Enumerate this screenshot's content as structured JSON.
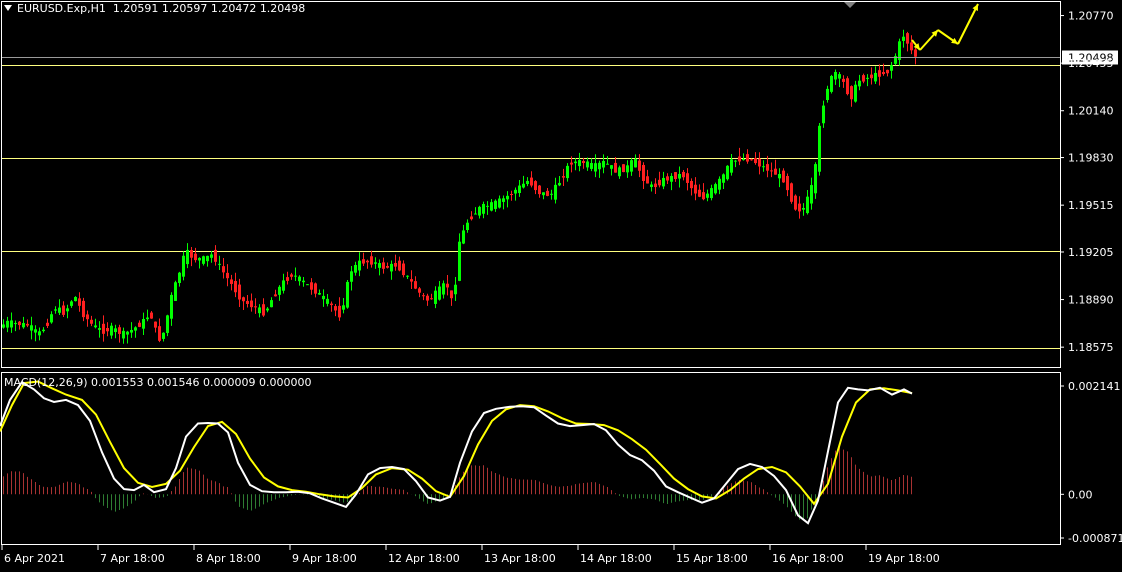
{
  "header": {
    "symbol": "EURUSD.Exp,H1",
    "ohlc": "1.20591 1.20597 1.20472 1.20498"
  },
  "macd": {
    "label": "MACD(12,26,9) 0.001553 0.001546 0.000009 0.000000",
    "axis_ticks": [
      "0.002141",
      "0.00",
      "-0.000871"
    ]
  },
  "price_axis": {
    "ticks": [
      "1.20770",
      "1.20455",
      "1.20140",
      "1.19830",
      "1.19515",
      "1.19205",
      "1.18890",
      "1.18575"
    ],
    "current_price": "1.20498"
  },
  "time_axis": {
    "labels": [
      "6 Apr 2021",
      "7 Apr 18:00",
      "8 Apr 18:00",
      "9 Apr 18:00",
      "12 Apr 18:00",
      "13 Apr 18:00",
      "14 Apr 18:00",
      "15 Apr 18:00",
      "16 Apr 18:00",
      "19 Apr 18:00"
    ]
  },
  "colors": {
    "background": "#000000",
    "bull_candle": "#00ff00",
    "bear_candle": "#ff2020",
    "level_line": "#ffff80",
    "arrow": "#ffff00",
    "macd_main": "#ffffff",
    "macd_signal": "#ffff00",
    "hist_pos": "#a83232",
    "hist_neg": "#2e7d32"
  },
  "chart_data": {
    "type": "candlestick",
    "symbol": "EURUSD.Exp",
    "timeframe": "H1",
    "ylim": [
      1.1849,
      1.2082
    ],
    "horizontal_levels": [
      1.2044,
      1.1983,
      1.1921,
      1.1857
    ],
    "price_points": [
      [
        0,
        1.187
      ],
      [
        8,
        1.1874
      ],
      [
        18,
        1.1873
      ],
      [
        30,
        1.1872
      ],
      [
        40,
        1.1866
      ],
      [
        48,
        1.1872
      ],
      [
        56,
        1.1884
      ],
      [
        66,
        1.188
      ],
      [
        76,
        1.1892
      ],
      [
        84,
        1.188
      ],
      [
        94,
        1.1872
      ],
      [
        104,
        1.1868
      ],
      [
        114,
        1.187
      ],
      [
        124,
        1.1866
      ],
      [
        134,
        1.1869
      ],
      [
        144,
        1.1874
      ],
      [
        152,
        1.188
      ],
      [
        160,
        1.1862
      ],
      [
        166,
        1.1868
      ],
      [
        172,
        1.1889
      ],
      [
        180,
        1.1905
      ],
      [
        187,
        1.1921
      ],
      [
        196,
        1.1916
      ],
      [
        206,
        1.1916
      ],
      [
        214,
        1.1919
      ],
      [
        222,
        1.191
      ],
      [
        232,
        1.19
      ],
      [
        244,
        1.1888
      ],
      [
        256,
        1.1884
      ],
      [
        266,
        1.188
      ],
      [
        274,
        1.189
      ],
      [
        284,
        1.19
      ],
      [
        294,
        1.1906
      ],
      [
        306,
        1.19
      ],
      [
        318,
        1.1894
      ],
      [
        330,
        1.1887
      ],
      [
        342,
        1.1878
      ],
      [
        352,
        1.1908
      ],
      [
        362,
        1.1914
      ],
      [
        374,
        1.1914
      ],
      [
        386,
        1.191
      ],
      [
        398,
        1.1912
      ],
      [
        410,
        1.1903
      ],
      [
        420,
        1.1894
      ],
      [
        430,
        1.1888
      ],
      [
        440,
        1.1895
      ],
      [
        448,
        1.19
      ],
      [
        455,
        1.1884
      ],
      [
        460,
        1.1926
      ],
      [
        470,
        1.1942
      ],
      [
        482,
        1.195
      ],
      [
        494,
        1.1952
      ],
      [
        506,
        1.1956
      ],
      [
        518,
        1.1962
      ],
      [
        530,
        1.1968
      ],
      [
        540,
        1.196
      ],
      [
        552,
        1.1958
      ],
      [
        562,
        1.1968
      ],
      [
        572,
        1.198
      ],
      [
        584,
        1.198
      ],
      [
        596,
        1.1977
      ],
      [
        606,
        1.198
      ],
      [
        618,
        1.1974
      ],
      [
        628,
        1.1976
      ],
      [
        636,
        1.1982
      ],
      [
        644,
        1.197
      ],
      [
        654,
        1.1963
      ],
      [
        664,
        1.1968
      ],
      [
        674,
        1.197
      ],
      [
        684,
        1.1972
      ],
      [
        694,
        1.1962
      ],
      [
        704,
        1.1956
      ],
      [
        714,
        1.1962
      ],
      [
        724,
        1.197
      ],
      [
        732,
        1.198
      ],
      [
        742,
        1.1982
      ],
      [
        752,
        1.1982
      ],
      [
        764,
        1.1977
      ],
      [
        776,
        1.1973
      ],
      [
        786,
        1.1968
      ],
      [
        796,
        1.195
      ],
      [
        804,
        1.1948
      ],
      [
        812,
        1.196
      ],
      [
        818,
        1.198
      ],
      [
        822,
        1.201
      ],
      [
        828,
        1.2028
      ],
      [
        836,
        1.204
      ],
      [
        844,
        1.2034
      ],
      [
        852,
        1.2022
      ],
      [
        860,
        1.2034
      ],
      [
        870,
        1.2036
      ],
      [
        880,
        1.2038
      ],
      [
        890,
        1.204
      ],
      [
        898,
        1.2052
      ],
      [
        904,
        1.2065
      ],
      [
        910,
        1.2058
      ],
      [
        916,
        1.205
      ]
    ],
    "macd_main": [
      [
        0,
        0.0013
      ],
      [
        10,
        0.0018
      ],
      [
        22,
        0.00214
      ],
      [
        34,
        0.002
      ],
      [
        44,
        0.00183
      ],
      [
        54,
        0.00176
      ],
      [
        66,
        0.0018
      ],
      [
        78,
        0.0017
      ],
      [
        90,
        0.0014
      ],
      [
        102,
        0.0008
      ],
      [
        114,
        0.0003
      ],
      [
        124,
        0.0001
      ],
      [
        134,
        8e-05
      ],
      [
        144,
        0.00018
      ],
      [
        154,
        4e-05
      ],
      [
        166,
        0.0001
      ],
      [
        176,
        0.0005
      ],
      [
        186,
        0.0011
      ],
      [
        198,
        0.00135
      ],
      [
        208,
        0.00136
      ],
      [
        218,
        0.00135
      ],
      [
        228,
        0.00118
      ],
      [
        238,
        0.0006
      ],
      [
        250,
        0.00018
      ],
      [
        262,
        6e-05
      ],
      [
        274,
        4e-05
      ],
      [
        286,
        4e-05
      ],
      [
        298,
        5e-05
      ],
      [
        310,
        2e-05
      ],
      [
        322,
        -8e-05
      ],
      [
        334,
        -0.00016
      ],
      [
        346,
        -0.00024
      ],
      [
        356,
        0.0
      ],
      [
        368,
        0.00038
      ],
      [
        380,
        0.0005
      ],
      [
        392,
        0.00052
      ],
      [
        404,
        0.00048
      ],
      [
        416,
        0.00025
      ],
      [
        428,
        -6e-05
      ],
      [
        440,
        -0.00012
      ],
      [
        450,
        -5e-05
      ],
      [
        460,
        0.0006
      ],
      [
        472,
        0.0012
      ],
      [
        484,
        0.00155
      ],
      [
        496,
        0.00163
      ],
      [
        510,
        0.00167
      ],
      [
        522,
        0.00168
      ],
      [
        534,
        0.00166
      ],
      [
        546,
        0.0015
      ],
      [
        558,
        0.00135
      ],
      [
        570,
        0.0013
      ],
      [
        582,
        0.00132
      ],
      [
        594,
        0.00134
      ],
      [
        606,
        0.00122
      ],
      [
        618,
        0.00095
      ],
      [
        630,
        0.00075
      ],
      [
        642,
        0.00065
      ],
      [
        654,
        0.00045
      ],
      [
        666,
        0.00015
      ],
      [
        678,
        4e-05
      ],
      [
        690,
        -6e-05
      ],
      [
        702,
        -0.00016
      ],
      [
        714,
        -8e-05
      ],
      [
        726,
        0.0002
      ],
      [
        738,
        0.00048
      ],
      [
        750,
        0.00058
      ],
      [
        762,
        0.00052
      ],
      [
        774,
        0.00035
      ],
      [
        786,
        8e-05
      ],
      [
        798,
        -0.0004
      ],
      [
        808,
        -0.00055
      ],
      [
        818,
        -0.00012
      ],
      [
        828,
        0.00082
      ],
      [
        838,
        0.00175
      ],
      [
        848,
        0.00203
      ],
      [
        858,
        0.002
      ],
      [
        868,
        0.00198
      ],
      [
        880,
        0.00203
      ],
      [
        892,
        0.0019
      ],
      [
        904,
        0.002
      ],
      [
        912,
        0.00192
      ]
    ],
    "macd_signal": [
      [
        0,
        0.0012
      ],
      [
        12,
        0.0017
      ],
      [
        24,
        0.00212
      ],
      [
        38,
        0.00215
      ],
      [
        52,
        0.00202
      ],
      [
        66,
        0.0019
      ],
      [
        82,
        0.0018
      ],
      [
        96,
        0.00152
      ],
      [
        110,
        0.001
      ],
      [
        124,
        0.0005
      ],
      [
        138,
        0.00022
      ],
      [
        152,
        0.00014
      ],
      [
        166,
        0.0002
      ],
      [
        180,
        0.00045
      ],
      [
        194,
        0.0009
      ],
      [
        208,
        0.0013
      ],
      [
        222,
        0.00138
      ],
      [
        236,
        0.00115
      ],
      [
        250,
        0.00068
      ],
      [
        264,
        0.00032
      ],
      [
        278,
        0.00015
      ],
      [
        292,
        8e-05
      ],
      [
        306,
        5e-05
      ],
      [
        320,
        0.0
      ],
      [
        334,
        -4e-05
      ],
      [
        348,
        -6e-05
      ],
      [
        362,
        0.00012
      ],
      [
        376,
        0.00038
      ],
      [
        392,
        0.0005
      ],
      [
        408,
        0.00047
      ],
      [
        422,
        0.0003
      ],
      [
        436,
        6e-05
      ],
      [
        450,
        -5e-05
      ],
      [
        464,
        0.00035
      ],
      [
        478,
        0.00095
      ],
      [
        492,
        0.0014
      ],
      [
        506,
        0.00162
      ],
      [
        520,
        0.0017
      ],
      [
        534,
        0.00168
      ],
      [
        548,
        0.00158
      ],
      [
        562,
        0.00145
      ],
      [
        576,
        0.00135
      ],
      [
        590,
        0.00134
      ],
      [
        604,
        0.00132
      ],
      [
        618,
        0.00122
      ],
      [
        632,
        0.00105
      ],
      [
        646,
        0.00085
      ],
      [
        660,
        0.00058
      ],
      [
        674,
        0.0003
      ],
      [
        688,
        0.0001
      ],
      [
        702,
        -4e-05
      ],
      [
        716,
        -8e-05
      ],
      [
        730,
        8e-05
      ],
      [
        744,
        0.0003
      ],
      [
        758,
        0.00048
      ],
      [
        772,
        0.00052
      ],
      [
        786,
        0.00042
      ],
      [
        800,
        0.00015
      ],
      [
        814,
        -0.00018
      ],
      [
        828,
        0.0002
      ],
      [
        842,
        0.0011
      ],
      [
        856,
        0.00175
      ],
      [
        870,
        0.002
      ],
      [
        884,
        0.00202
      ],
      [
        898,
        0.00198
      ],
      [
        912,
        0.00193
      ]
    ],
    "histogram_ylim": [
      -0.000871,
      0.002141
    ]
  }
}
